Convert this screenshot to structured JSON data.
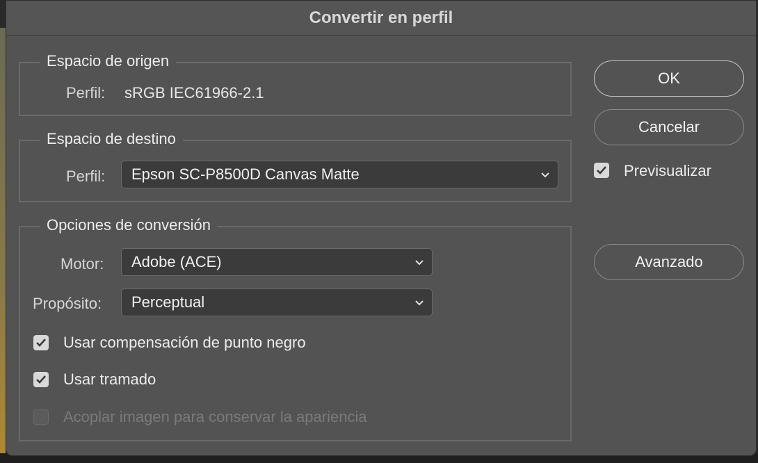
{
  "dialog": {
    "title": "Convertir en perfil"
  },
  "source": {
    "legend": "Espacio de origen",
    "profile_label": "Perfil:",
    "profile_value": "sRGB IEC61966-2.1"
  },
  "destination": {
    "legend": "Espacio de destino",
    "profile_label": "Perfil:",
    "profile_selected": "Epson SC-P8500D Canvas Matte"
  },
  "options": {
    "legend": "Opciones de conversión",
    "engine_label": "Motor:",
    "engine_selected": "Adobe (ACE)",
    "intent_label": "Propósito:",
    "intent_selected": "Perceptual",
    "checkboxes": [
      {
        "label": "Usar compensación de punto negro",
        "checked": true,
        "enabled": true
      },
      {
        "label": "Usar tramado",
        "checked": true,
        "enabled": true
      },
      {
        "label": "Acoplar imagen para conservar la apariencia",
        "checked": false,
        "enabled": false
      }
    ]
  },
  "buttons": {
    "ok": "OK",
    "cancel": "Cancelar",
    "advanced": "Avanzado"
  },
  "preview": {
    "label": "Previsualizar",
    "checked": true
  },
  "icons": {
    "checkbox_check": "checkmark-icon",
    "select_chevron": "chevron-down-icon"
  },
  "colors": {
    "dialog_bg": "#535353",
    "field_bg": "#3b3b3b",
    "text": "#e6e6e6",
    "disabled_text": "#7a7a7a"
  }
}
